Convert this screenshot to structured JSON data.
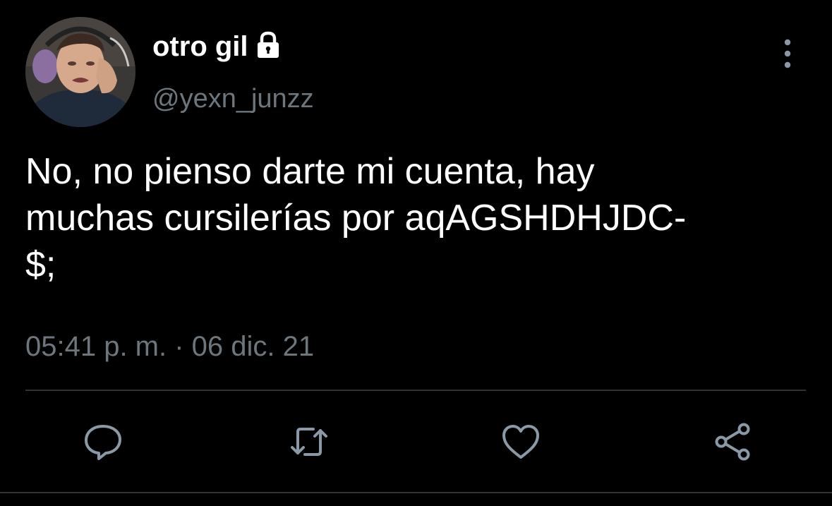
{
  "tweet": {
    "author": {
      "display_name": "otro gil",
      "handle": "@yexn_junzz",
      "protected_icon": "lock-icon"
    },
    "text": "No, no pienso darte mi cuenta, hay\nmuchas cursilerías por aqAGSHDHJDC-\n$;",
    "timestamp": "05:41 p. m. · 06 dic. 21",
    "menu_icon": "more-vertical-icon",
    "actions": [
      {
        "name": "reply",
        "icon": "reply-icon"
      },
      {
        "name": "retweet",
        "icon": "retweet-icon"
      },
      {
        "name": "like",
        "icon": "heart-icon"
      },
      {
        "name": "share",
        "icon": "share-icon"
      }
    ]
  },
  "colors": {
    "background": "#000000",
    "primary_text": "#ffffff",
    "secondary_text": "#6e767d",
    "icon": "#8b98a5",
    "divider": "#2f3336"
  }
}
